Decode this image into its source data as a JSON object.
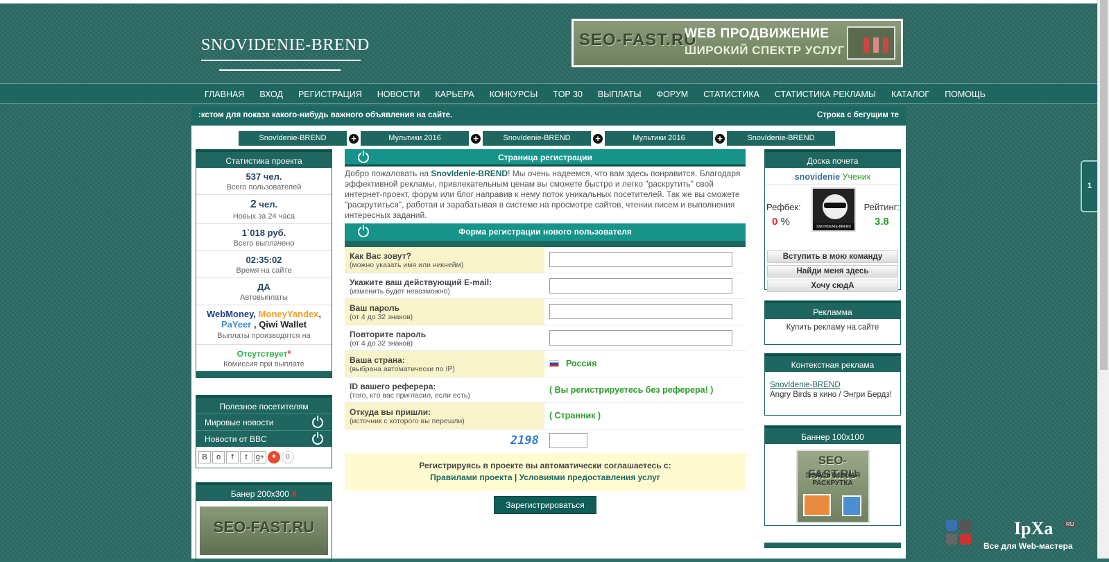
{
  "site": {
    "logo": "SNOVIDENIE-BREND"
  },
  "top_banner": {
    "brand": "SEO-FAST.RU",
    "line1": "WEB ПРОДВИЖЕНИЕ",
    "line2": "ШИРОКИЙ СПЕКТР УСЛУГ"
  },
  "nav": [
    "ГЛАВНАЯ",
    "ВХОД",
    "РЕГИСТРАЦИЯ",
    "НОВОСТИ",
    "КАРЬЕРА",
    "КОНКУРСЫ",
    "TOP 30",
    "ВЫПЛАТЫ",
    "ФОРУМ",
    "СТАТИСТИКА",
    "СТАТИСТИКА РЕКЛАМЫ",
    "КАТАЛОГ",
    "ПОМОЩЬ"
  ],
  "ticker": {
    "left": ":кстом для показа какого-нибудь важного объявления на сайте.",
    "right": "Строка с бегущим те"
  },
  "tabs": [
    "SnovIdenie-BREND",
    "Мультики 2016",
    "SnovIdenie-BREND",
    "Мультики 2016",
    "SnovIdenie-BREND"
  ],
  "stats": {
    "title": "Статистика проекта",
    "users_value": "537 чел.",
    "users_label": "Всего пользователей",
    "new_value_num": "2",
    "new_value_unit": " чел.",
    "new_label": "Новых за 24 часа",
    "paid_value": "1`018 руб.",
    "paid_label": "Всего выплачено",
    "time_value": "02:35:02",
    "time_label": "Время на сайте",
    "auto_value": "ДА",
    "auto_label": "Автовыплаты",
    "pay_webmoney": "WebMoney",
    "pay_yandex": "MoneyYandex",
    "pay_payeer": "PaYeer",
    "pay_qiwi": "Qiwi Wallet",
    "pay_comma": ",",
    "pay_comma2": ",",
    "pay_comma3": " ,",
    "pay_label": "Выплаты производятся на",
    "fee_value": "Отсутствует",
    "fee_star": "*",
    "fee_label": "Комиссия при выплате"
  },
  "useful": {
    "title": "Полезное посетителям",
    "items": [
      "Мировые новости",
      "Новости от BBC"
    ],
    "share_count": "0"
  },
  "banner200": {
    "title": "Банер 200х300",
    "close": "X",
    "brand": "SEO-FAST.RU"
  },
  "registration": {
    "title": "Страница регистрации",
    "intro_pre": "Добро пожаловать на ",
    "intro_brand": "SnovIdenie-BREND",
    "intro_post": "! Мы очень надеемся, что вам здесь понравится. Благодаря эффективной рекламы, привлекательным ценам вы сможете быстро и легко \"раскрутить\" свой интернет-проект, форум или блог направив к нему поток уникальных посетителей. Так же вы сможете \"раскрутиться\", работая и зарабатывая в системе на просмотре сайтов, чтении писем и выполнения интересных заданий.",
    "form_title": "Форма регистрации нового пользователя",
    "fields": [
      {
        "label": "Как Вас зовут?",
        "hint": "(можно указать имя или никнейм)"
      },
      {
        "label": "Укажите ваш действующий E-mail:",
        "hint": "(изменить будет невозможно)"
      },
      {
        "label": "Ваш пароль",
        "hint": "(от 4 до 32 знаков)"
      },
      {
        "label": "Повторите пароль",
        "hint": "(от 4 до 32 знаков)"
      },
      {
        "label": "Ваша страна:",
        "hint": "(выбрана автоматически по IP)",
        "value": "Россия"
      },
      {
        "label": "ID вашего реферера:",
        "hint": "(того, кто вас пригласил, если есть)",
        "value": "( Вы регистрируетесь без реферера! )"
      },
      {
        "label": "Откуда вы пришли:",
        "hint": "(источник с которого вы перешли)",
        "value": "( Странник )"
      }
    ],
    "captcha": "2198",
    "agree_text": "Регистрируясь в проекте вы автоматически соглашаетесь с:",
    "rules_link": "Правилами проекта",
    "sep": " | ",
    "terms_link": "Условиями предоставления услуг",
    "submit": "Зарегистрироваться"
  },
  "honor": {
    "title": "Доска почета",
    "user": "snovidenie",
    "rank": " Ученик",
    "ref_label": "Рефбек:",
    "ref_value": "0",
    "ref_unit": " %",
    "rating_label": "Рейтинг:",
    "rating_value": "3.8",
    "avatar_caption": "SNOVIDENIE-BREND",
    "buttons": [
      "Вступить в мою команду",
      "Найди меня здесь",
      "Хочу сюдА"
    ]
  },
  "ads": {
    "title": "Рекламма",
    "link": "Купить рекламу на сайте"
  },
  "context_ads": {
    "title": "Контекстная реклама",
    "link": "SnovIdenie-BREND",
    "text": "Angry Birds в кино / Энгри Бердз!"
  },
  "banner100": {
    "title": "Баннер 100х100",
    "brand": "SEO-FAST.RU",
    "text": "ЭФФЕКТИВНАЯ РАСКРУТКА"
  },
  "side_tab": {
    "label": "1"
  },
  "watermark": {
    "brand": "IpXa",
    "ru": "RU",
    "sub": "Все для Web-мастера"
  },
  "colors": {
    "primary": "#1f6660",
    "accent": "#17948a",
    "highlight": "#f8f3c9",
    "green": "#2a9d2a"
  },
  "icons": [
    "power-icon",
    "plus-icon",
    "flag-ru-icon",
    "share-vk-icon",
    "share-ok-icon",
    "share-fb-icon",
    "share-twitter-icon",
    "share-gplus-icon"
  ]
}
